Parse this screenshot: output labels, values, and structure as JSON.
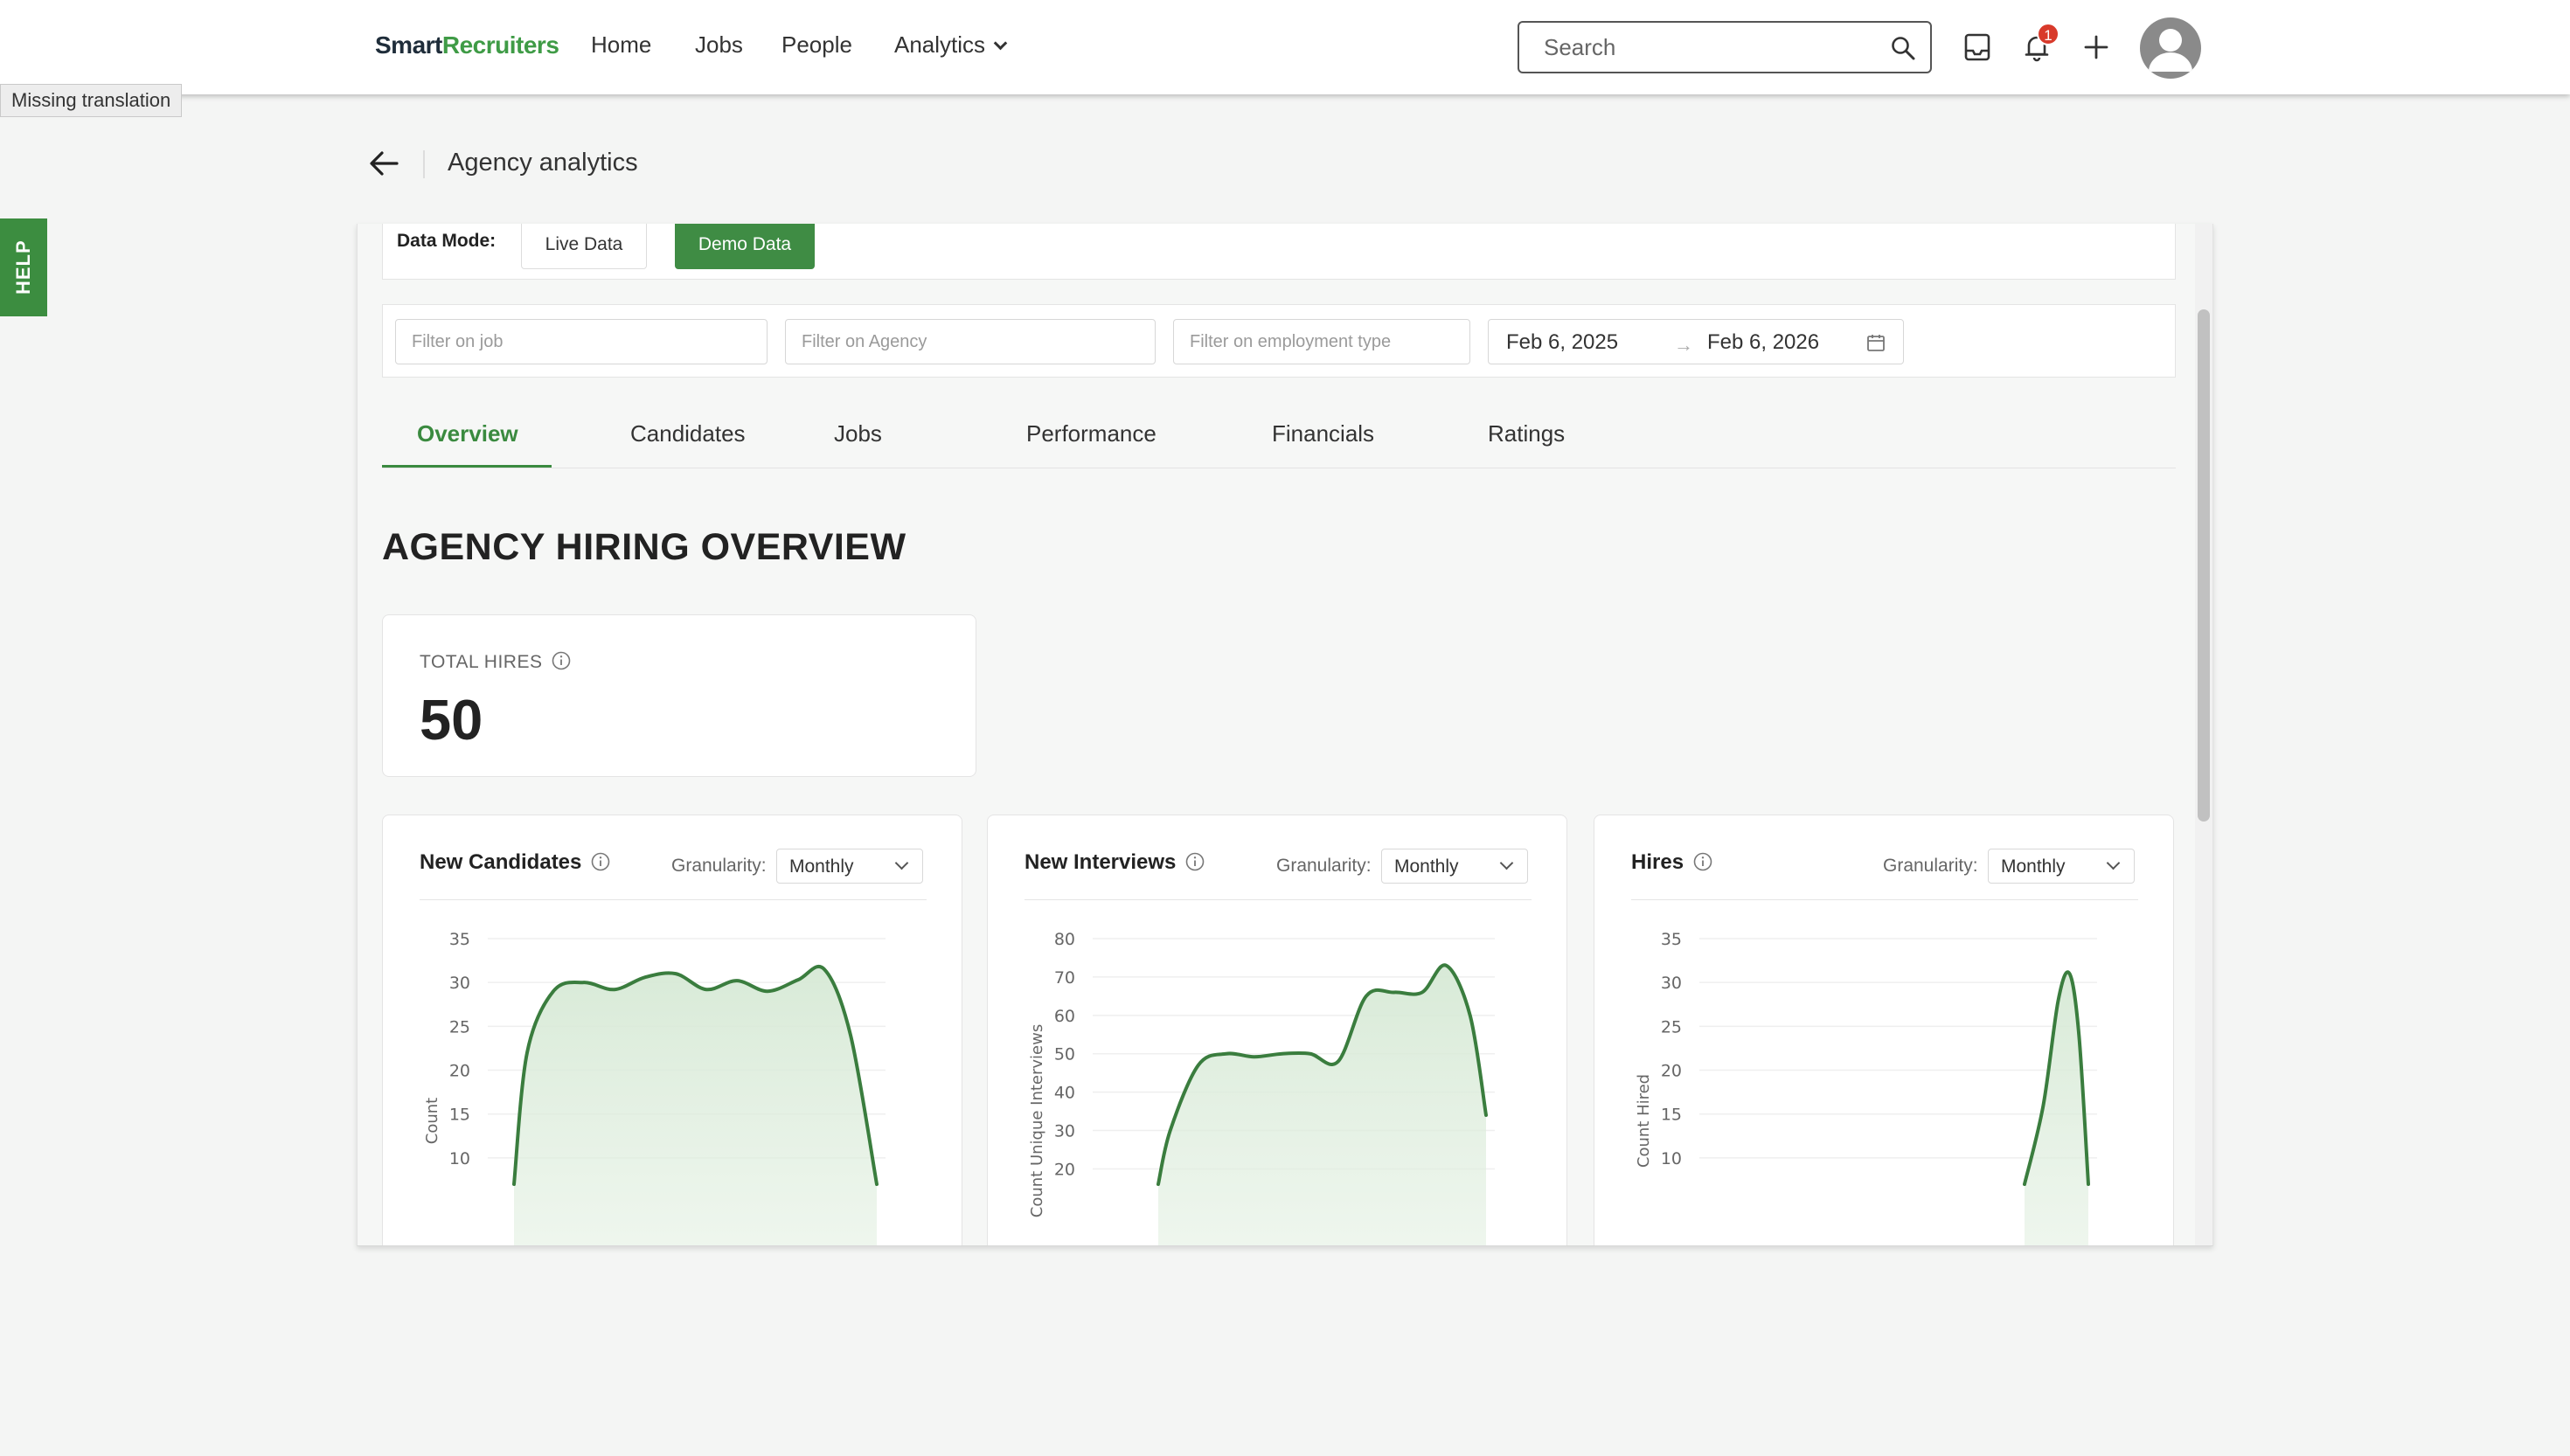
{
  "nav": {
    "logo_smart": "Smart",
    "logo_recruiters": "Recruiters",
    "links": {
      "home": "Home",
      "jobs": "Jobs",
      "people": "People",
      "analytics": "Analytics"
    },
    "search_placeholder": "Search",
    "notification_count": "1",
    "icons": [
      "search-icon",
      "inbox-icon",
      "bell-icon",
      "plus-icon",
      "avatar"
    ]
  },
  "tooltip": "Missing translation",
  "help": "HELP",
  "header": {
    "title": "Agency analytics"
  },
  "data_mode": {
    "label": "Data Mode:",
    "live": "Live Data",
    "demo": "Demo Data",
    "selected": "Demo Data"
  },
  "filters": {
    "job_placeholder": "Filter on job",
    "agency_placeholder": "Filter on Agency",
    "employment_placeholder": "Filter on employment type",
    "date_start": "Feb 6, 2025",
    "date_end": "Feb 6, 2026"
  },
  "tabs": [
    "Overview",
    "Candidates",
    "Jobs",
    "Performance",
    "Financials",
    "Ratings"
  ],
  "active_tab": "Overview",
  "section_title": "AGENCY HIRING OVERVIEW",
  "total_hires": {
    "label": "TOTAL HIRES",
    "value": "50"
  },
  "granularity_label": "Granularity:",
  "colors": {
    "accent": "#3f8c44",
    "line": "#3a7d3e",
    "fill": "#e3f0e2",
    "badge": "#d83a2b"
  },
  "chart_data": [
    {
      "type": "area",
      "title": "New Candidates",
      "granularity": "Monthly",
      "ylabel": "Count",
      "yticks": [
        10,
        15,
        20,
        25,
        30,
        35
      ],
      "ylim": [
        7,
        35
      ],
      "x": [
        0,
        0.3,
        0.9,
        1.6,
        2.3,
        3,
        3.7,
        4.4,
        5.1,
        5.8,
        6.5,
        7.1,
        7.7,
        8.3
      ],
      "values": [
        7,
        22,
        29,
        30,
        29.2,
        30.6,
        31,
        29.2,
        30.2,
        29,
        30.3,
        31.5,
        24,
        7
      ]
    },
    {
      "type": "area",
      "title": "New Interviews",
      "granularity": "Monthly",
      "ylabel": "Count Unique Interviews",
      "yticks": [
        20,
        30,
        40,
        50,
        60,
        70,
        80
      ],
      "ylim": [
        16,
        80
      ],
      "x": [
        0,
        0.3,
        1,
        1.7,
        2.4,
        3.1,
        3.8,
        4.5,
        5.2,
        5.9,
        6.6,
        7.2,
        7.8,
        8.2
      ],
      "values": [
        16,
        30,
        47,
        50,
        49.2,
        50,
        50,
        48,
        65,
        66,
        66,
        73,
        60,
        34
      ]
    },
    {
      "type": "area",
      "title": "Hires",
      "granularity": "Monthly",
      "ylabel": "Count Hired",
      "yticks": [
        10,
        15,
        20,
        25,
        30,
        35
      ],
      "ylim": [
        7,
        35
      ],
      "x": [
        0,
        0.5,
        0.9,
        1.2,
        1.45,
        1.7
      ],
      "values": [
        7,
        16,
        28,
        31,
        24,
        7
      ]
    }
  ]
}
